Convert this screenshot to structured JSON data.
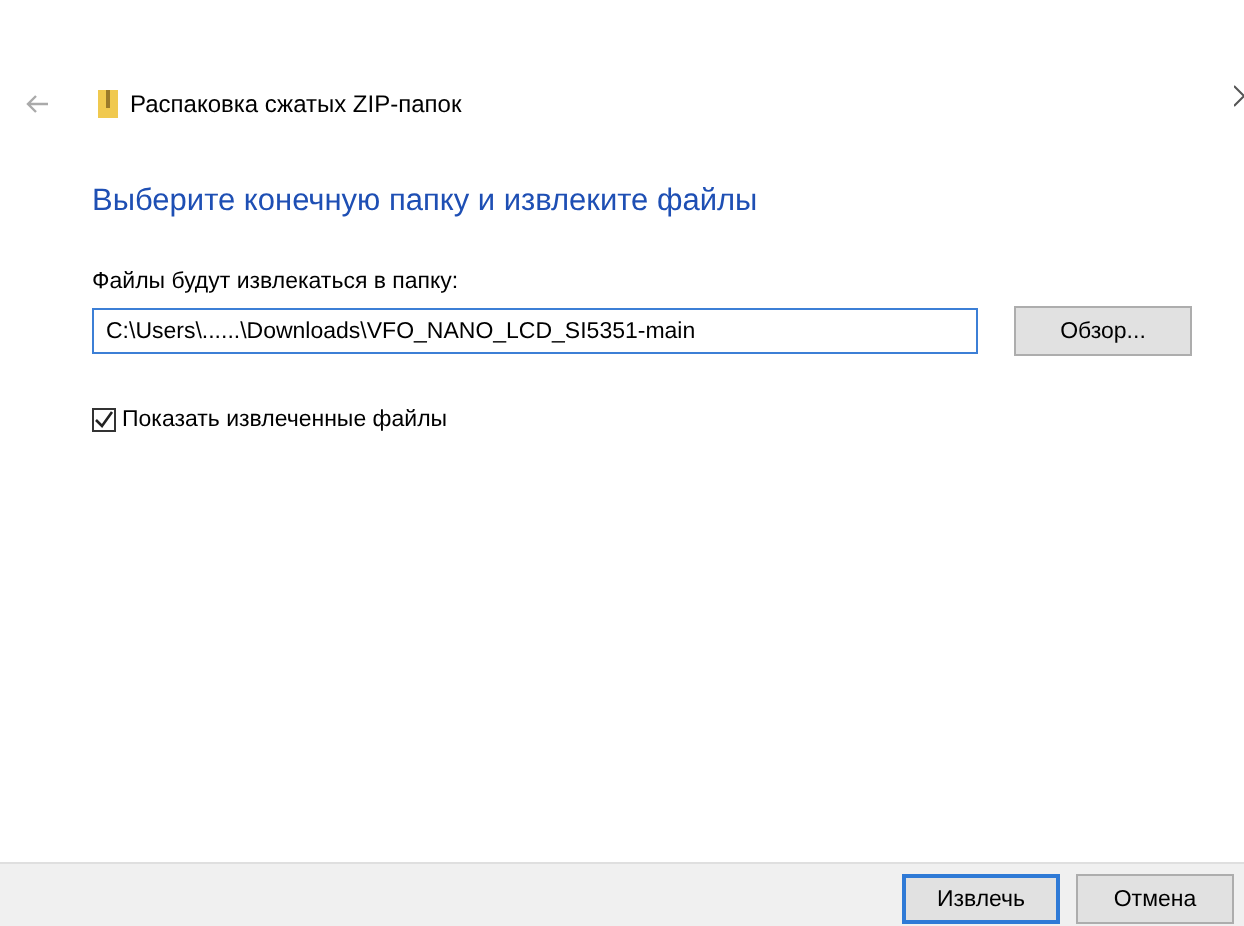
{
  "window": {
    "title": "Распаковка сжатых ZIP-папок"
  },
  "heading": "Выберите конечную папку и извлеките файлы",
  "destination": {
    "label": "Файлы будут извлекаться в папку:",
    "value": "C:\\Users\\......\\Downloads\\VFO_NANO_LCD_SI5351-main",
    "browse": "Обзор..."
  },
  "show_files": {
    "label": "Показать извлеченные файлы",
    "checked": true
  },
  "buttons": [
    {
      "label": "Извлечь",
      "kind": "primary"
    },
    {
      "label": "Отмена",
      "kind": "normal"
    }
  ]
}
